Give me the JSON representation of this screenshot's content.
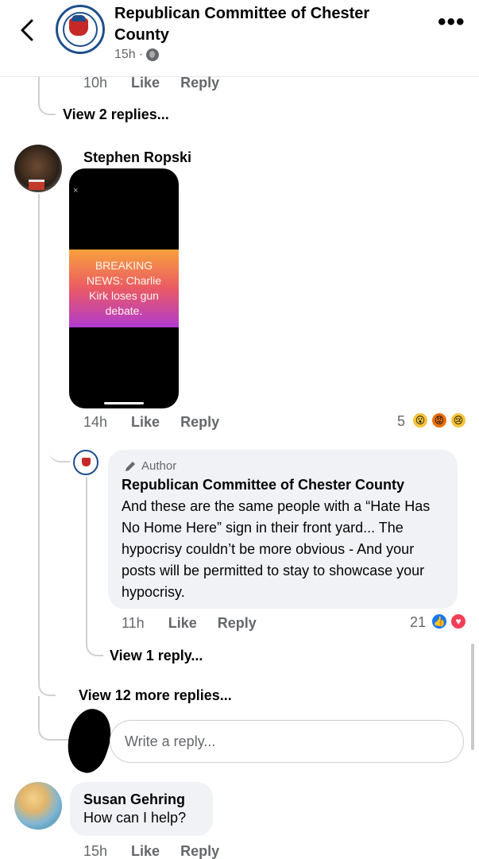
{
  "header": {
    "page_name": "Republican Committee of Chester County",
    "time": "15h",
    "separator": "·"
  },
  "top_meta": {
    "time": "10h",
    "like": "Like",
    "reply": "Reply"
  },
  "view_2_replies": "View 2 replies...",
  "comment_stephen": {
    "name": "Stephen Ropski",
    "media_text": "BREAKING NEWS: Charlie Kirk loses gun debate.",
    "media_close": "×",
    "time": "14h",
    "like": "Like",
    "reply": "Reply",
    "reaction_count": "5",
    "reactions": [
      "wow",
      "angry",
      "sad"
    ]
  },
  "author_reply": {
    "badge": "Author",
    "name": "Republican Committee of Chester County",
    "text": "And these are the same people with a “Hate Has No Home Here” sign in their front yard... The hypocrisy couldn’t be more obvious - And your posts will be permitted to stay to showcase your hypocrisy.",
    "time": "11h",
    "like": "Like",
    "reply": "Reply",
    "reaction_count": "21",
    "reactions": [
      "like",
      "love"
    ]
  },
  "view_1_reply": "View 1 reply...",
  "view_12_more": "View 12 more replies...",
  "reply_input": {
    "placeholder": "Write a reply..."
  },
  "comment_susan": {
    "name": "Susan Gehring",
    "text": "How can I help?",
    "time": "15h",
    "like": "Like",
    "reply": "Reply"
  },
  "colors": {
    "brand_blue": "#1877f2",
    "meta_grey": "#65676b",
    "bubble_bg": "#f0f2f5",
    "thread_line": "#ced0d4"
  }
}
